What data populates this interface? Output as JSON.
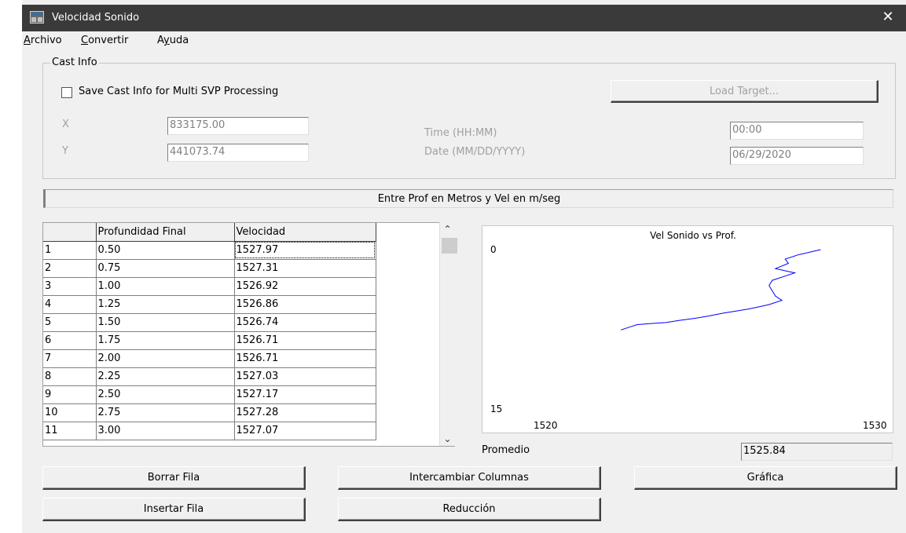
{
  "window": {
    "title": "Velocidad Sonido",
    "close_glyph": "✕"
  },
  "menu": [
    {
      "key": "A",
      "rest": "rchivo"
    },
    {
      "key": "C",
      "rest": "onvertir"
    },
    {
      "pre": "A",
      "key": "y",
      "rest": "uda"
    }
  ],
  "cast_info": {
    "group_label": "Cast Info",
    "checkbox_label": "Save Cast Info for Multi SVP Processing",
    "checked": false,
    "load_target_label": "Load Target...",
    "x_label": "X",
    "x_value": "833175.00",
    "y_label": "Y",
    "y_value": "441073.74",
    "time_label": "Time (HH:MM)",
    "time_value": "00:00",
    "date_label": "Date (MM/DD/YYYY)",
    "date_value": "06/29/2020"
  },
  "instruction": "Entre Prof en Metros y Vel en m/seg",
  "table": {
    "headers": [
      "",
      "Profundidad Final",
      "Velocidad"
    ],
    "rows": [
      [
        "1",
        "0.50",
        "1527.97"
      ],
      [
        "2",
        "0.75",
        "1527.31"
      ],
      [
        "3",
        "1.00",
        "1526.92"
      ],
      [
        "4",
        "1.25",
        "1526.86"
      ],
      [
        "5",
        "1.50",
        "1526.74"
      ],
      [
        "6",
        "1.75",
        "1526.71"
      ],
      [
        "7",
        "2.00",
        "1526.71"
      ],
      [
        "8",
        "2.25",
        "1527.03"
      ],
      [
        "9",
        "2.50",
        "1527.17"
      ],
      [
        "10",
        "2.75",
        "1527.28"
      ],
      [
        "11",
        "3.00",
        "1527.07"
      ]
    ]
  },
  "chart_data": {
    "type": "line",
    "title": "Vel Sonido vs Prof.",
    "xlim": [
      1520,
      1530
    ],
    "ylim": [
      0,
      15
    ],
    "y_inverted": true,
    "x_ticks": [
      "1520",
      "1530"
    ],
    "y_ticks": [
      "0",
      "15"
    ],
    "series": [
      {
        "color": "#0000ff",
        "x": [
          1528.3,
          1527.6,
          1527.2,
          1527.3,
          1526.9,
          1527.5,
          1527.2,
          1526.8,
          1526.7,
          1526.8,
          1526.9,
          1527.1,
          1526.7,
          1526.4,
          1526.1,
          1525.7,
          1525.3,
          1524.8,
          1524.4,
          1523.9,
          1523.5,
          1523.0,
          1522.6,
          1522.4,
          1522.1
        ],
        "y": [
          0.0,
          0.5,
          0.9,
          1.3,
          1.8,
          2.2,
          2.5,
          2.9,
          3.4,
          3.9,
          4.4,
          4.8,
          5.2,
          5.4,
          5.6,
          5.8,
          6.0,
          6.3,
          6.5,
          6.7,
          6.9,
          7.0,
          7.1,
          7.3,
          7.6
        ]
      }
    ]
  },
  "promedio": {
    "label": "Promedio",
    "value": "1525.84"
  },
  "buttons": {
    "borrar": "Borrar Fila",
    "intercambiar": "Intercambiar Columnas",
    "grafica": "Gráfica",
    "insertar": "Insertar Fila",
    "reduccion": "Reducción"
  }
}
